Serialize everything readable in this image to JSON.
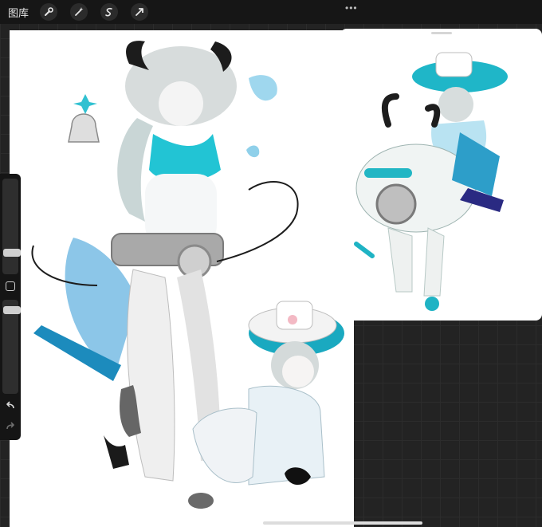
{
  "topbar": {
    "gallery_label": "图库",
    "tools": [
      {
        "name": "wrench-icon"
      },
      {
        "name": "magic-wand-icon"
      },
      {
        "name": "selection-icon"
      },
      {
        "name": "transform-arrow-icon"
      }
    ],
    "more_icon": "•••"
  },
  "canvas": {
    "description_icon": "character-illustration"
  },
  "reference_window": {
    "visible": true
  },
  "sidebar": {
    "brush_size_level": 0.35,
    "opacity_level": 0.2
  },
  "colors": {
    "accent_teal": "#19b6c9",
    "horn_black": "#1a1a1a",
    "toolbar_bg": "#161616"
  }
}
